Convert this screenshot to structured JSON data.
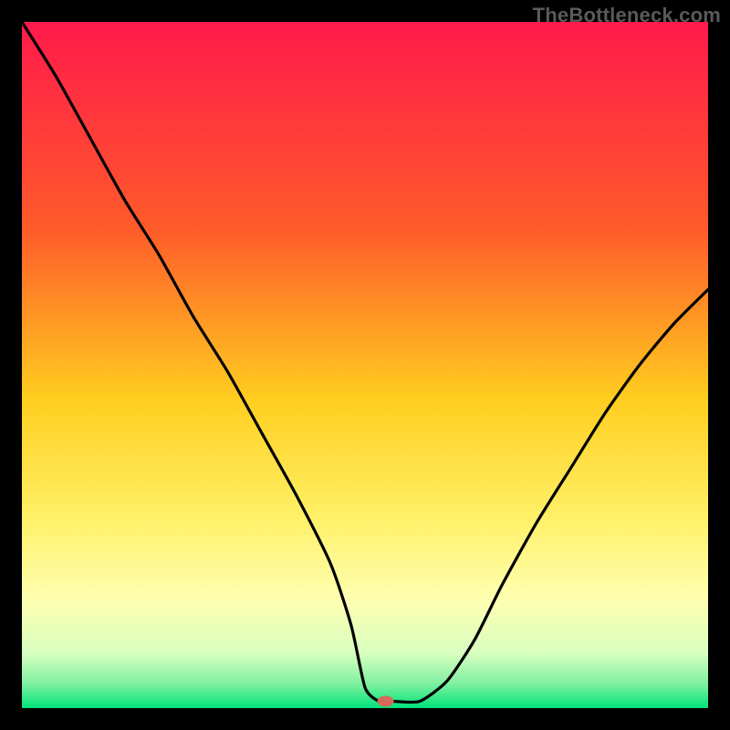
{
  "watermark": "TheBottleneck.com",
  "chart_data": {
    "type": "line",
    "title": "",
    "xlabel": "",
    "ylabel": "",
    "xlim": [
      0,
      100
    ],
    "ylim": [
      0,
      100
    ],
    "grid": false,
    "legend": false,
    "gradient_stops": [
      {
        "offset": 0,
        "color": "#ff1a4b"
      },
      {
        "offset": 0.3,
        "color": "#ff5a2a"
      },
      {
        "offset": 0.55,
        "color": "#ffce1f"
      },
      {
        "offset": 0.72,
        "color": "#fff066"
      },
      {
        "offset": 0.84,
        "color": "#ffffb0"
      },
      {
        "offset": 0.92,
        "color": "#d8ffc0"
      },
      {
        "offset": 0.965,
        "color": "#7ef0a0"
      },
      {
        "offset": 1.0,
        "color": "#00e37a"
      }
    ],
    "series": [
      {
        "name": "bottleneck-curve",
        "x": [
          0,
          5,
          10,
          15,
          20,
          25,
          30,
          35,
          40,
          45,
          48,
          50,
          52,
          54,
          58,
          62,
          66,
          70,
          75,
          80,
          85,
          90,
          95,
          100
        ],
        "values": [
          100,
          92,
          83,
          74,
          66,
          57,
          49,
          40,
          31,
          21,
          12,
          3,
          1,
          1,
          1,
          4,
          10,
          18,
          27,
          35,
          43,
          50,
          56,
          61
        ]
      }
    ],
    "marker": {
      "x": 53,
      "y": 1,
      "color": "#d46a5a",
      "rx": 9,
      "ry": 6
    },
    "flat_region": {
      "x_start": 48,
      "x_end": 58,
      "y": 1
    }
  }
}
